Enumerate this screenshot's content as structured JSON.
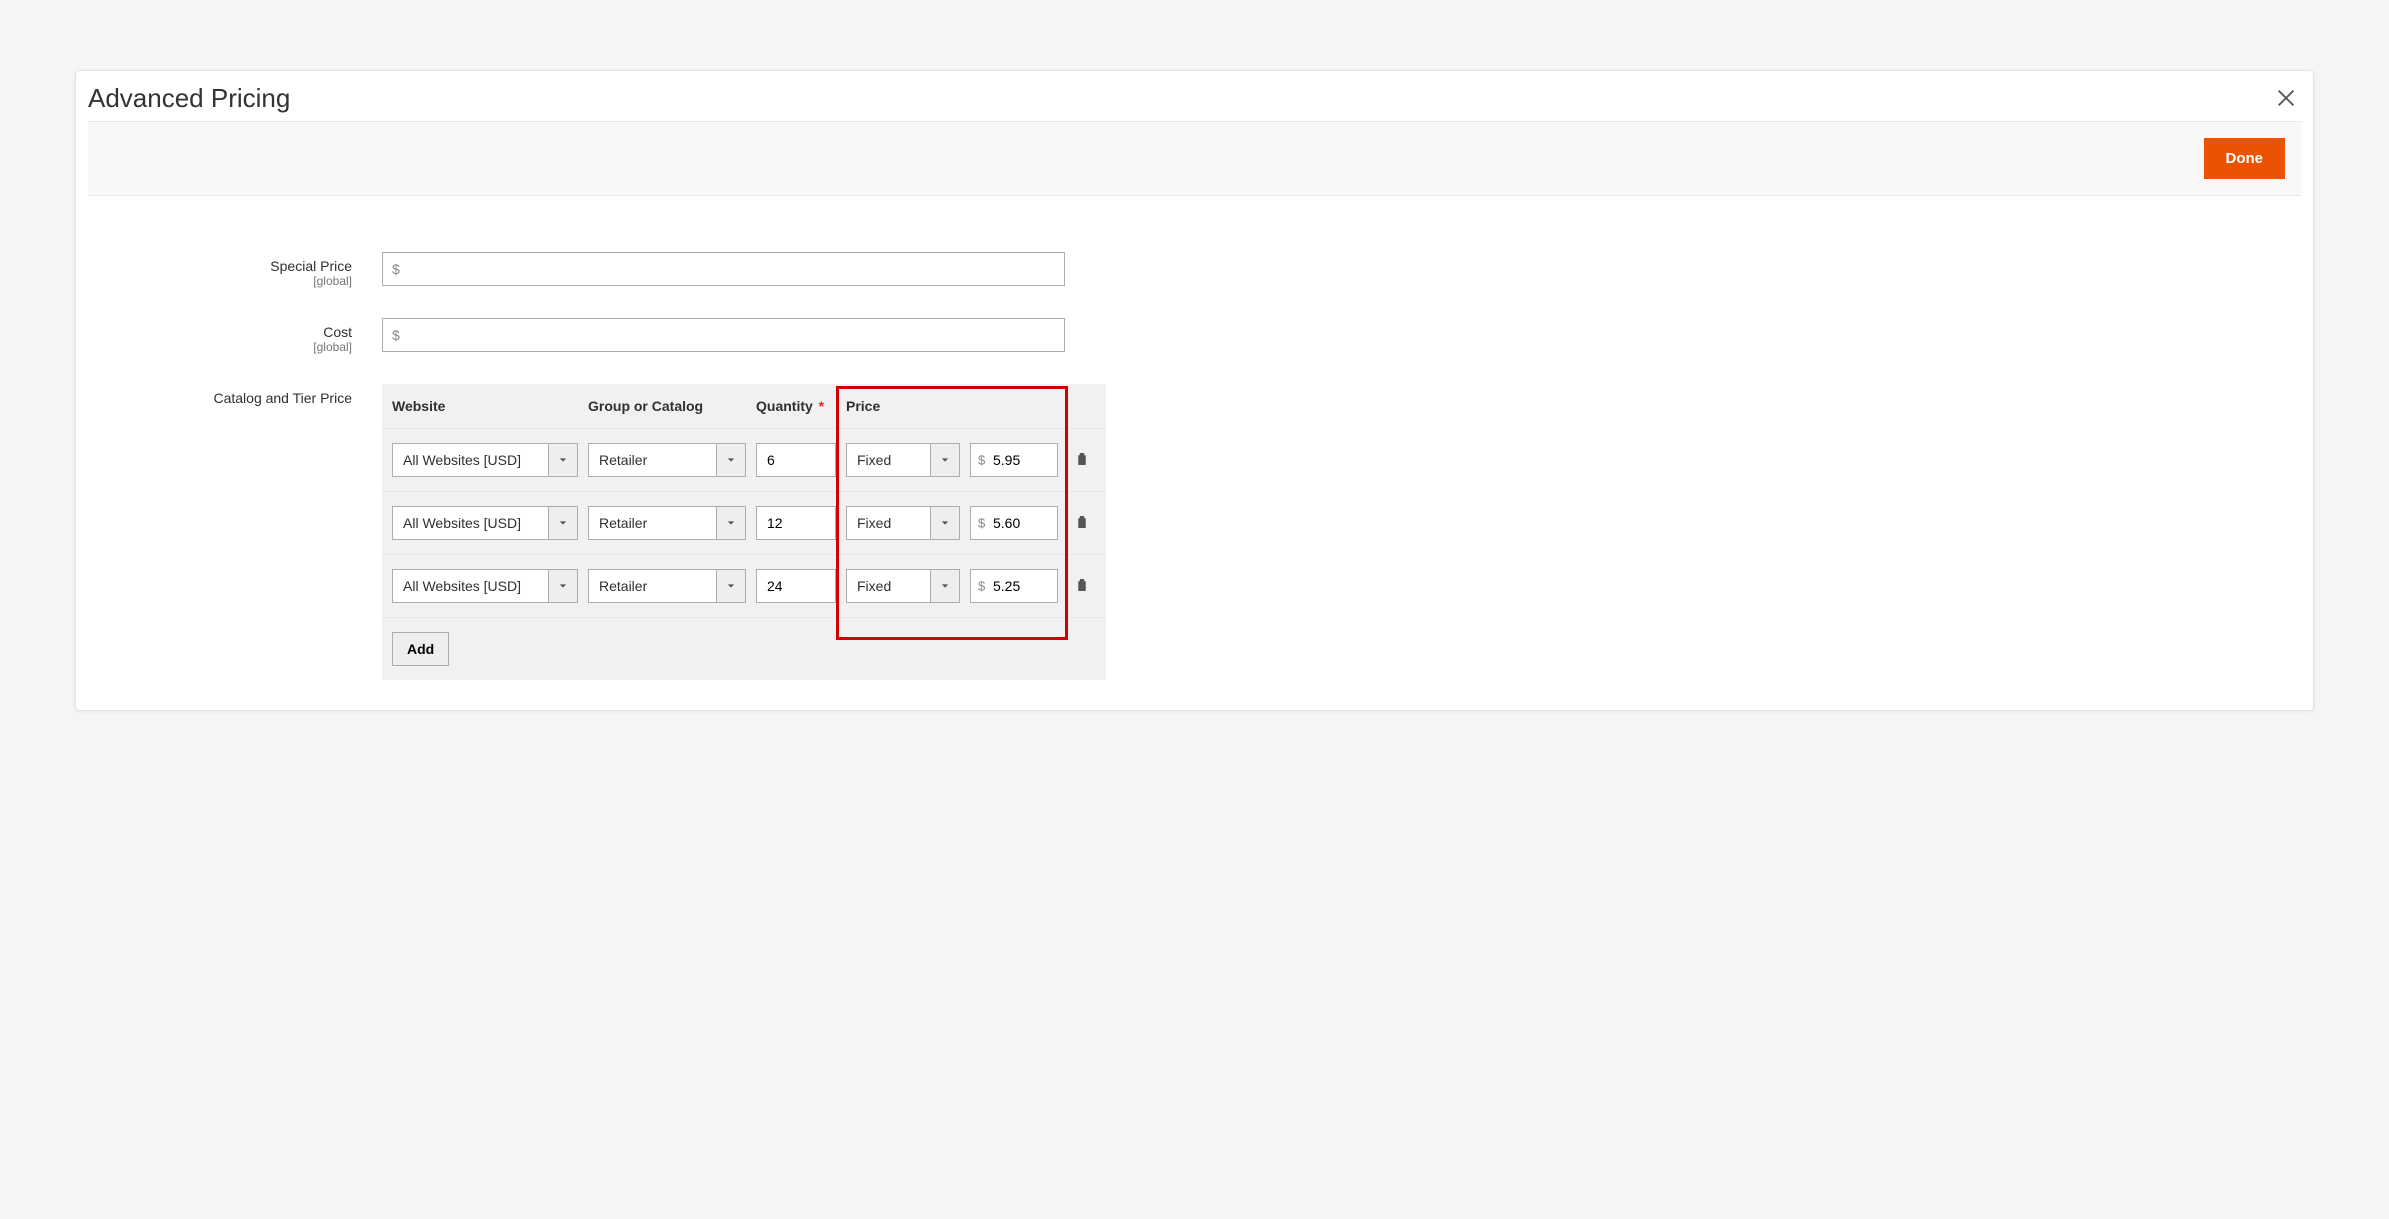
{
  "modal": {
    "title": "Advanced Pricing",
    "done_label": "Done"
  },
  "fields": {
    "special_price": {
      "label": "Special Price",
      "scope": "[global]",
      "prefix": "$",
      "value": ""
    },
    "cost": {
      "label": "Cost",
      "scope": "[global]",
      "prefix": "$",
      "value": ""
    },
    "tier_price_label": "Catalog and Tier Price"
  },
  "tier_table": {
    "headers": {
      "website": "Website",
      "group": "Group or Catalog",
      "qty": "Quantity",
      "price": "Price"
    },
    "required_marker": "*",
    "price_currency_prefix": "$",
    "rows": [
      {
        "website": "All Websites [USD]",
        "group": "Retailer",
        "qty": "6",
        "price_type": "Fixed",
        "price": "5.95"
      },
      {
        "website": "All Websites [USD]",
        "group": "Retailer",
        "qty": "12",
        "price_type": "Fixed",
        "price": "5.60"
      },
      {
        "website": "All Websites [USD]",
        "group": "Retailer",
        "qty": "24",
        "price_type": "Fixed",
        "price": "5.25"
      }
    ],
    "add_label": "Add"
  }
}
